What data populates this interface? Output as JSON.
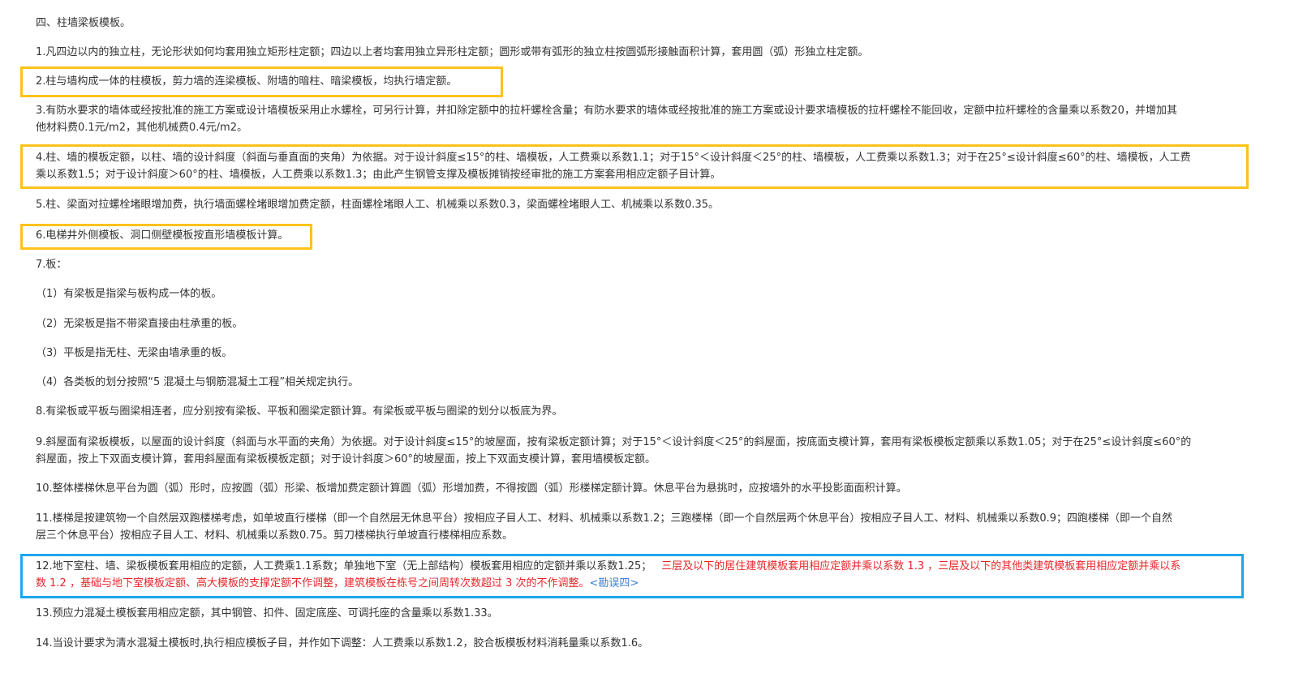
{
  "section_title": "四、柱墙梁板模板。",
  "items": {
    "i1": "1.凡四边以内的独立柱，无论形状如何均套用独立矩形柱定额；四边以上者均套用独立异形柱定额；圆形或带有弧形的独立柱按圆弧形接触面积计算，套用圆（弧）形独立柱定额。",
    "i2": "2.柱与墙构成一体的柱模板，剪力墙的连梁模板、附墙的暗柱、暗梁模板，均执行墙定额。",
    "i3a": "3.有防水要求的墙体或经按批准的施工方案或设计墙模板采用止水螺栓，可另行计算，并扣除定额中的拉杆螺栓含量；有防水要求的墙体或经按批准的施工方案或设计要求墙模板的拉杆螺栓不能回收，定额中拉杆螺栓的含量乘以系数20，并增加其",
    "i3b": "他材料费0.1元/m2，其他机械费0.4元/m2。",
    "i4a": "4.柱、墙的模板定额，以柱、墙的设计斜度（斜面与垂直面的夹角）为依据。对于设计斜度≤15°的柱、墙模板，人工费乘以系数1.1；对于15°＜设计斜度＜25°的柱、墙模板，人工费乘以系数1.3；对于在25°≤设计斜度≤60°的柱、墙模板，人工费",
    "i4b": "乘以系数1.5；对于设计斜度＞60°的柱、墙模板，人工费乘以系数1.3；由此产生钢管支撑及模板摊销按经审批的施工方案套用相应定额子目计算。",
    "i5": "5.柱、梁面对拉螺栓堵眼增加费，执行墙面螺栓堵眼增加费定额，柱面螺栓堵眼人工、机械乘以系数0.3，梁面螺栓堵眼人工、机械乘以系数0.35。",
    "i6": "6.电梯井外侧模板、洞口侧壁模板按直形墙模板计算。",
    "i7": "7.板：",
    "i7_1": "（1）有梁板是指梁与板构成一体的板。",
    "i7_2": "（2）无梁板是指不带梁直接由柱承重的板。",
    "i7_3": "（3）平板是指无柱、无梁由墙承重的板。",
    "i7_4": "（4）各类板的划分按照“5 混凝土与钢筋混凝土工程”相关规定执行。",
    "i8": "8.有梁板或平板与圈梁相连者，应分别按有梁板、平板和圈梁定额计算。有梁板或平板与圈梁的划分以板底为界。",
    "i9a": "9.斜屋面有梁板模板，以屋面的设计斜度（斜面与水平面的夹角）为依据。对于设计斜度≤15°的坡屋面，按有梁板定额计算；对于15°＜设计斜度＜25°的斜屋面，按底面支模计算，套用有梁板模板定额乘以系数1.05；对于在25°≤设计斜度≤60°的",
    "i9b": "斜屋面，按上下双面支模计算，套用斜屋面有梁板模板定额；对于设计斜度＞60°的坡屋面，按上下双面支模计算，套用墙模板定额。",
    "i10": "10.整体楼梯休息平台为圆（弧）形时，应按圆（弧）形梁、板增加费定额计算圆（弧）形增加费，不得按圆（弧）形楼梯定额计算。休息平台为悬挑时，应按墙外的水平投影面面积计算。",
    "i11a": "11.楼梯是按建筑物一个自然层双跑楼梯考虑，如单坡直行楼梯（即一个自然层无休息平台）按相应子目人工、材料、机械乘以系数1.2；三跑楼梯（即一个自然层两个休息平台）按相应子目人工、材料、机械乘以系数0.9；四跑楼梯（即一个自然",
    "i11b": "层三个休息平台）按相应子目人工、材料、机械乘以系数0.75。剪刀楼梯执行单坡直行楼梯相应系数。",
    "i12a_black": "12.地下室柱、墙、梁板模板套用相应的定额，人工费乘1.1系数；单独地下室（无上部结构）模板套用相应的定额并乘以系数1.25；",
    "i12a_red": "三层及以下的居住建筑模板套用相应定额并乘以系数 1.3 ，三层及以下的其他类建筑模板套用相应定额并乘以系",
    "i12b_red": "数 1.2 ，基础与地下室模板定额、高大模板的支撑定额不作调整，建筑模板在栋号之间周转次数超过 3 次的不作调整。",
    "i12b_link": "<勘误四>",
    "i13": "13.预应力混凝土模板套用相应定额，其中钢管、扣件、固定底座、可调托座的含量乘以系数1.33。",
    "i14": "14.当设计要求为清水混凝土模板时,执行相应模板子目，并作如下调整：人工费乘以系数1.2，胶合板模板材料消耗量乘以系数1.6。"
  },
  "colors": {
    "highlight_yellow": "#ffc21a",
    "highlight_blue": "#1fa5ec",
    "erratum_red": "#e8262a",
    "link_blue": "#3b7fd6"
  }
}
